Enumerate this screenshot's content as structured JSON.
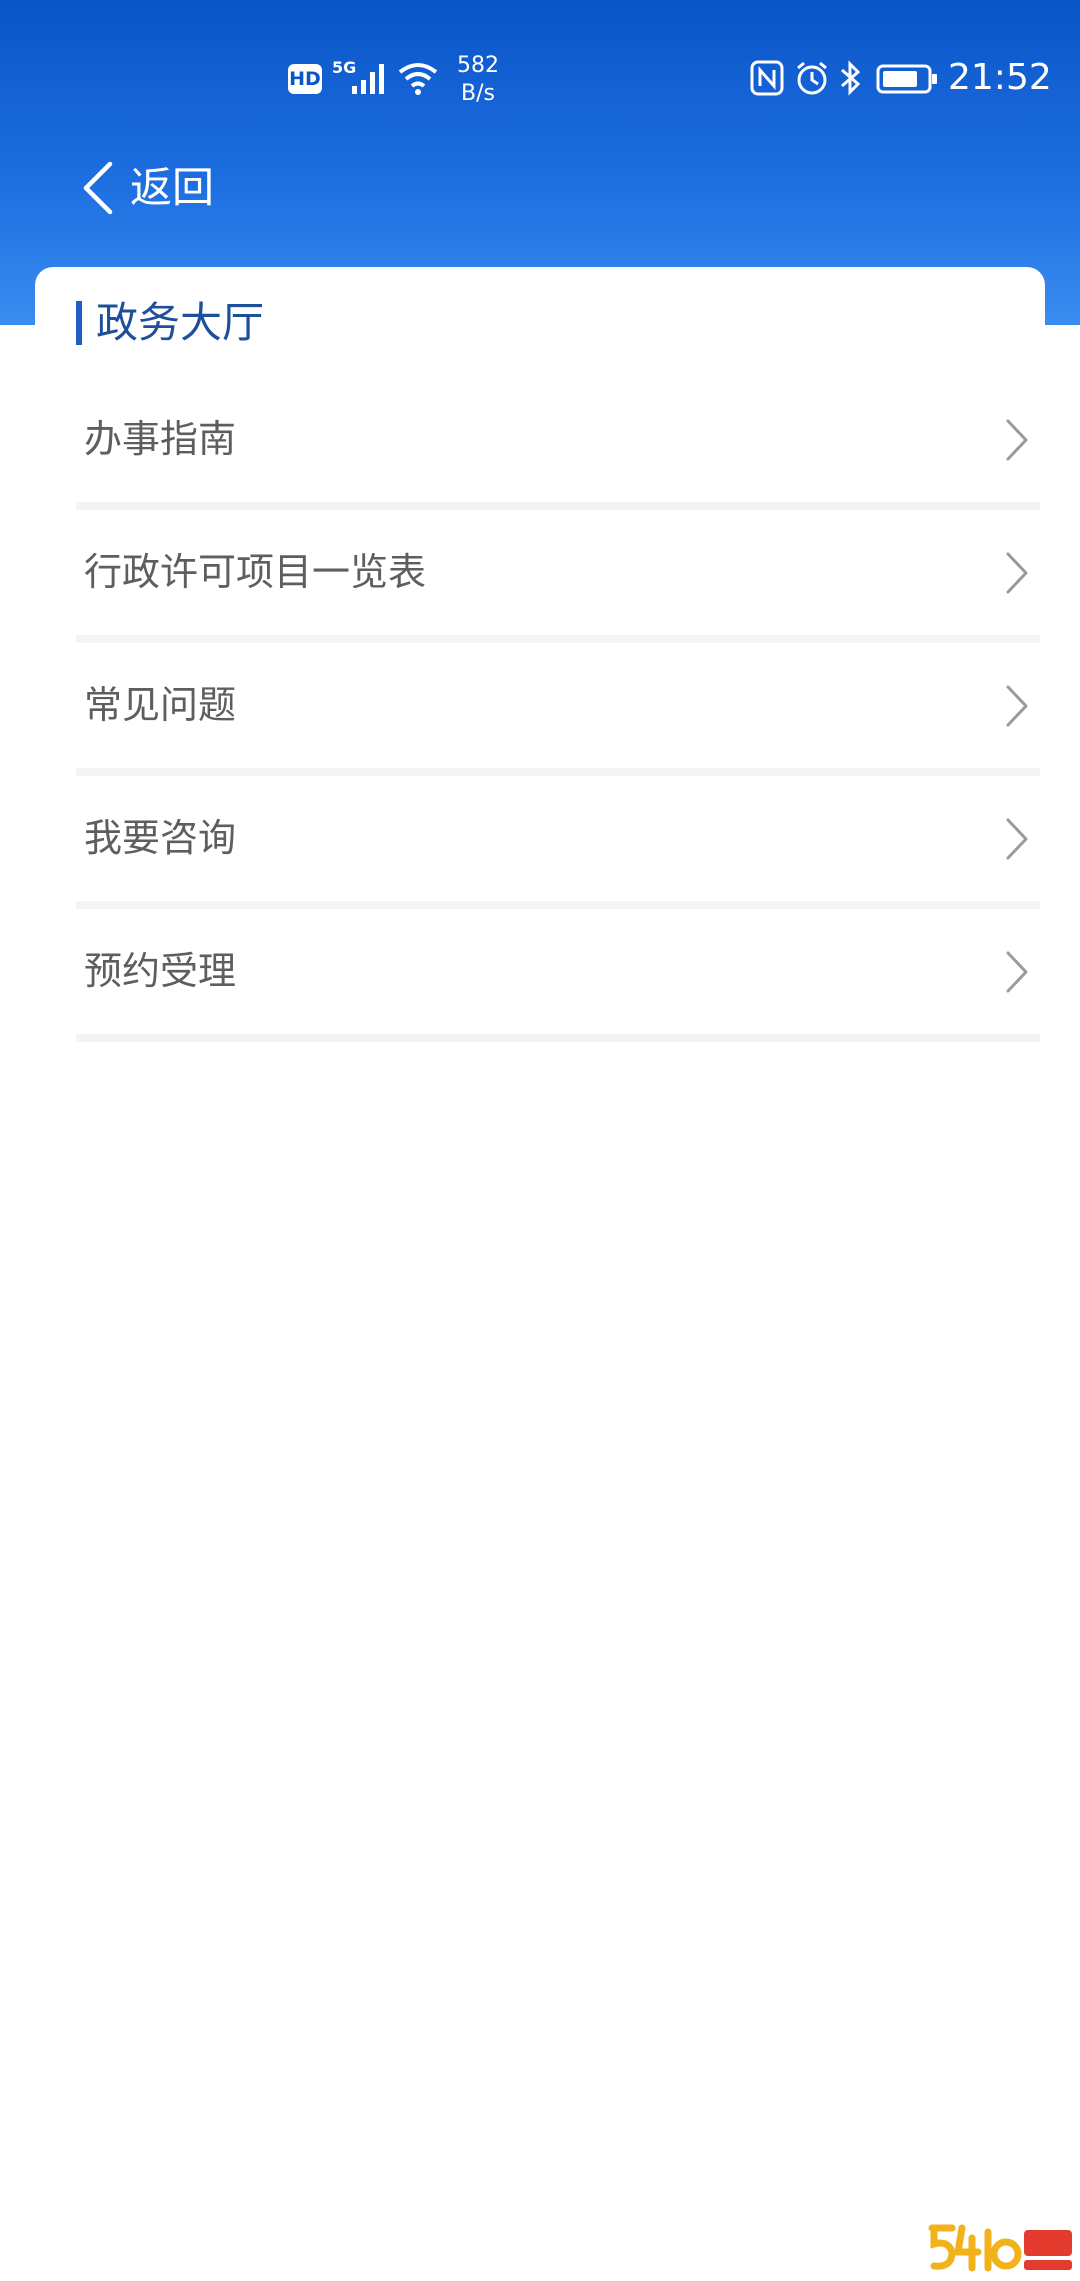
{
  "status_bar": {
    "hd_label": "HD",
    "network_label": "5G",
    "speed_value": "582",
    "speed_unit": "B/s",
    "time": "21:52",
    "icons": [
      "hd-icon",
      "signal-icon",
      "wifi-icon",
      "nfc-icon",
      "alarm-icon",
      "bluetooth-icon",
      "battery-icon"
    ]
  },
  "nav": {
    "back_label": "返回"
  },
  "section": {
    "title": "政务大厅"
  },
  "menu": {
    "items": [
      {
        "label": "办事指南"
      },
      {
        "label": "行政许可项目一览表"
      },
      {
        "label": "常见问题"
      },
      {
        "label": "我要咨询"
      },
      {
        "label": "预约受理"
      }
    ]
  },
  "colors": {
    "header_top": "#0a55c8",
    "header_bottom": "#3a8cf0",
    "accent": "#1f5fc4",
    "title_text": "#1d4f9b",
    "item_text": "#5e5e5e",
    "divider": "#f3f4f6"
  }
}
